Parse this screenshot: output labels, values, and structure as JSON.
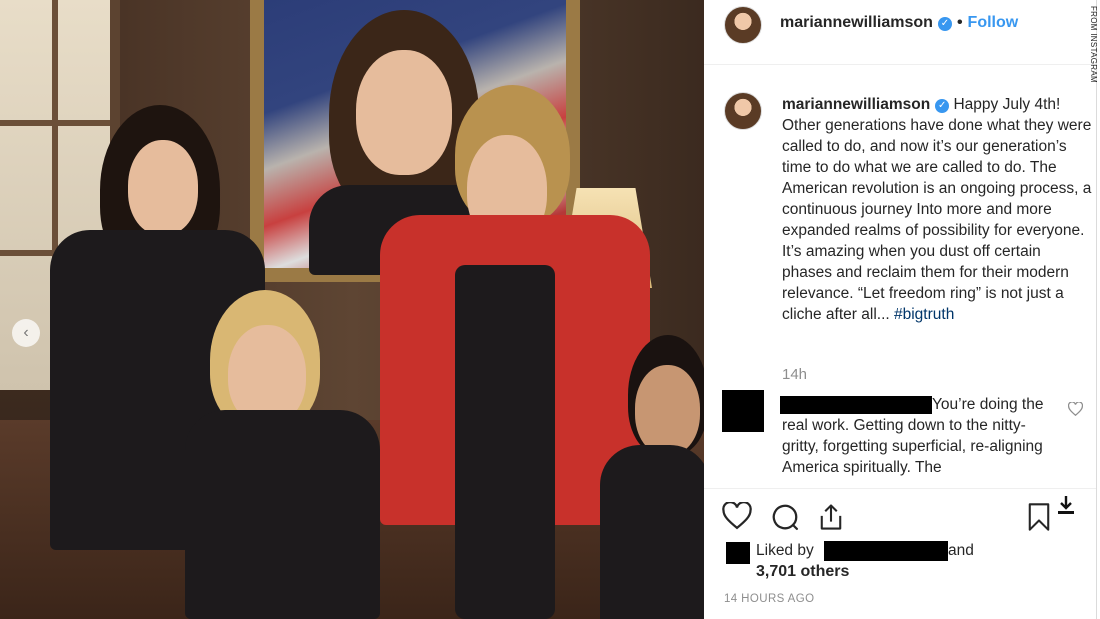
{
  "credit": "FROM INSTAGRAM",
  "post": {
    "username": "mariannewilliamson",
    "verified_icon": "verified-badge-icon",
    "separator": "•",
    "follow_label": "Follow",
    "caption": "Happy July 4th! Other generations have done what they were called to do, and now it’s our generation’s time to do what we are called to do. The American revolution is an ongoing process, a continuous journey Into more and more expanded realms of possibility for everyone. It’s amazing when you dust off certain phases and reclaim them for their modern relevance. “Let freedom ring” is not just a cliche after all...",
    "hashtag": "#bigtruth",
    "caption_age": "14h",
    "carousel_prev_icon": "chevron-left-icon"
  },
  "comment": {
    "text": "You’re doing the real work. Getting down to the nitty-gritty, forgetting superficial, re-aligning America spiritually. The"
  },
  "actions": {
    "icons": [
      "heart-icon",
      "comment-icon",
      "share-icon",
      "bookmark-icon",
      "download-icon"
    ]
  },
  "likes": {
    "liked_by_label": "Liked by",
    "and_label": "and",
    "others_label": "3,701 others"
  },
  "timestamp": "14 HOURS AGO",
  "colors": {
    "accent": "#3897f0",
    "text": "#262626",
    "muted": "#8e8e8e",
    "hashtag": "#003569"
  }
}
